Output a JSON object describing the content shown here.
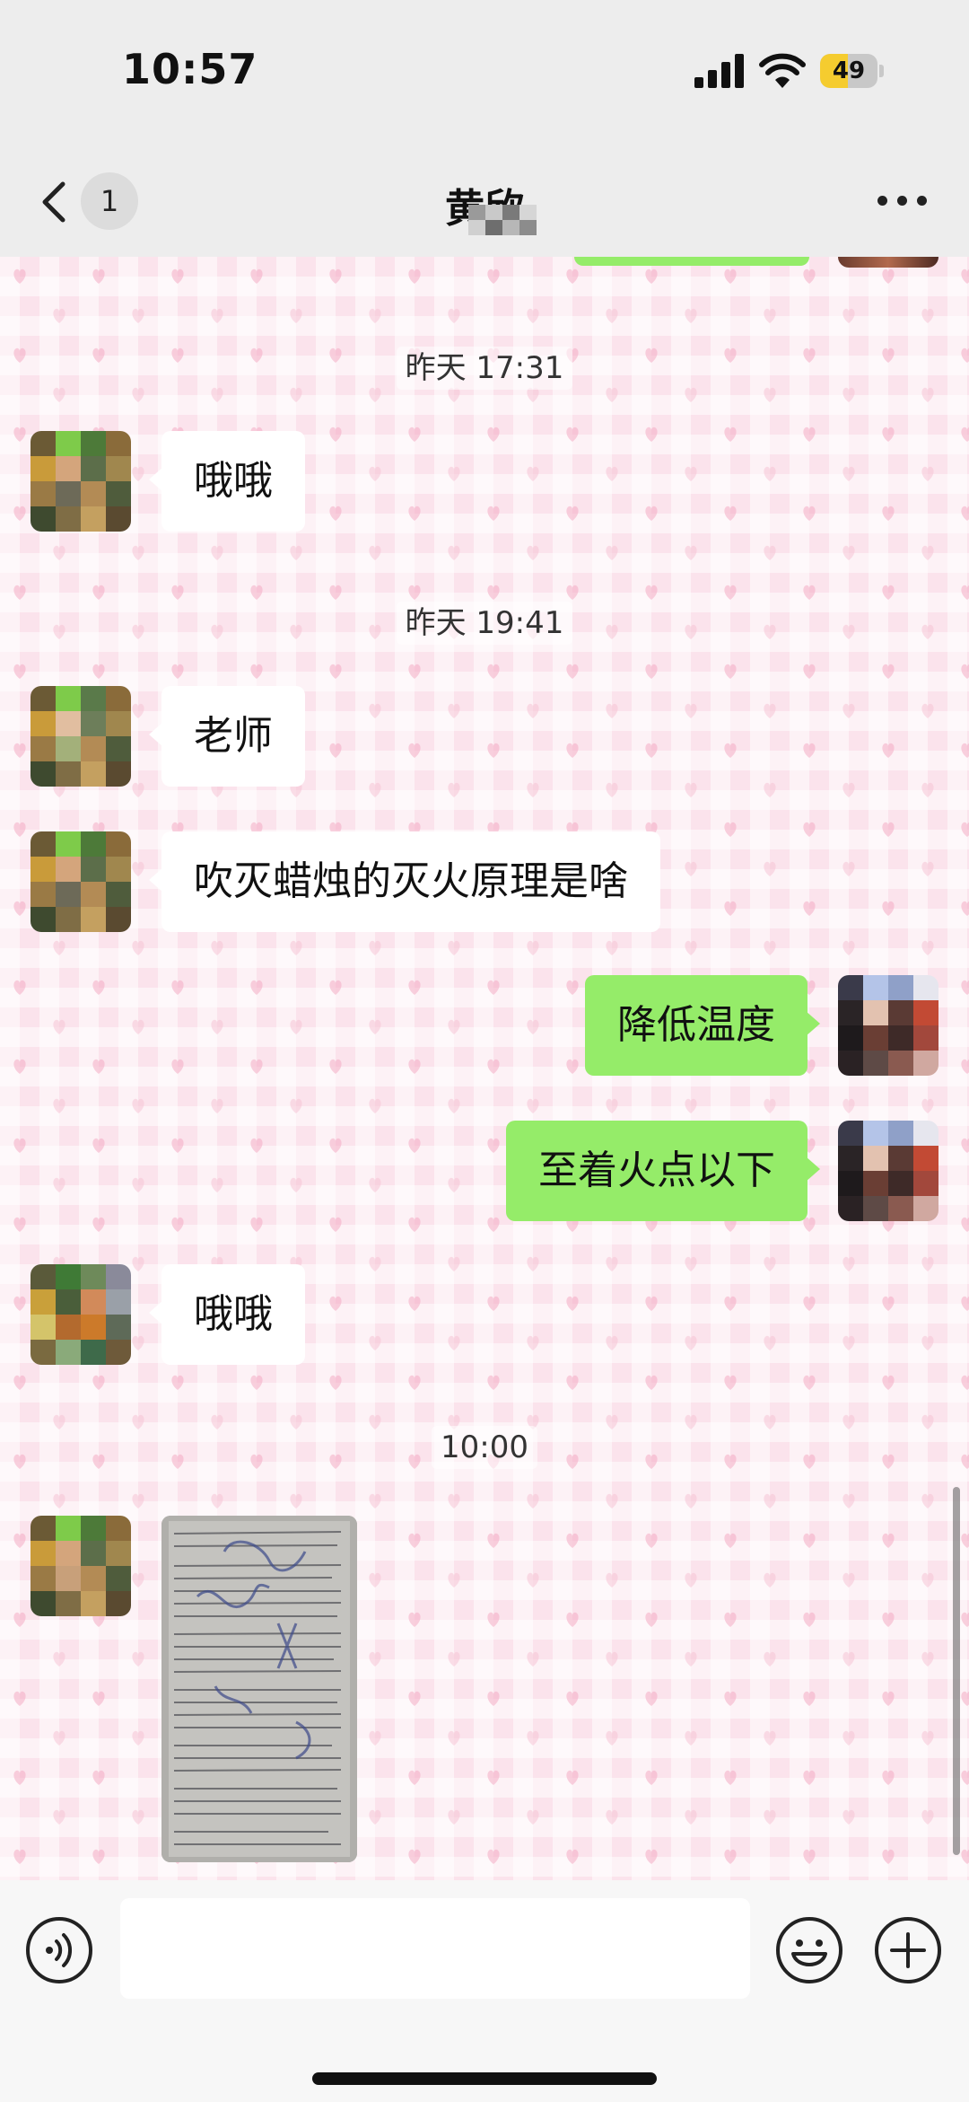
{
  "status_bar": {
    "time": "10:57",
    "battery_level": "49",
    "battery_fraction": 0.49,
    "icons": [
      "signal-icon",
      "wifi-icon",
      "battery-icon"
    ]
  },
  "nav": {
    "unread_count": "1",
    "title": "黄欣",
    "icons": [
      "chevron-left-icon",
      "more-icon"
    ]
  },
  "chat": {
    "timestamps": [
      "昨天 17:31",
      "昨天 19:41",
      "10:00"
    ],
    "messages": [
      {
        "side": "in",
        "text": "哦哦"
      },
      {
        "side": "in",
        "text": "老师"
      },
      {
        "side": "in",
        "text": "吹灭蜡烛的灭火原理是啥"
      },
      {
        "side": "out",
        "text": "降低温度"
      },
      {
        "side": "out",
        "text": "至着火点以下"
      },
      {
        "side": "in",
        "text": "哦哦"
      },
      {
        "side": "in",
        "type": "image",
        "text": ""
      }
    ]
  },
  "input_bar": {
    "placeholder": "",
    "icons": [
      "voice-icon",
      "emoji-icon",
      "plus-icon"
    ]
  },
  "colors": {
    "outgoing_bubble": "#95ec69",
    "incoming_bubble": "#ffffff",
    "chat_background": "#fbe3ec",
    "bar_background": "#ededed"
  }
}
